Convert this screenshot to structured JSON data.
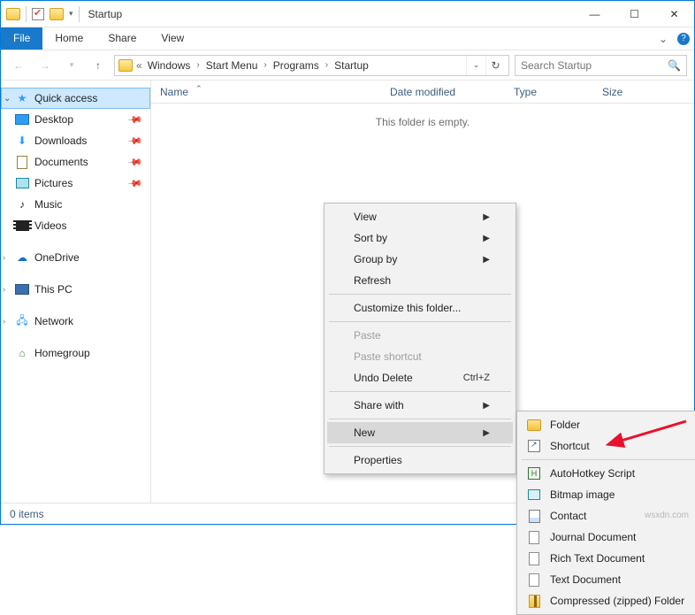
{
  "window": {
    "title": "Startup"
  },
  "ribbon": {
    "file": "File",
    "tabs": [
      "Home",
      "Share",
      "View"
    ]
  },
  "address": {
    "crumbs": [
      "Windows",
      "Start Menu",
      "Programs",
      "Startup"
    ]
  },
  "search": {
    "placeholder": "Search Startup"
  },
  "nav": {
    "quick_access": "Quick access",
    "pinned": [
      {
        "label": "Desktop"
      },
      {
        "label": "Downloads"
      },
      {
        "label": "Documents"
      },
      {
        "label": "Pictures"
      }
    ],
    "recent": [
      {
        "label": "Music"
      },
      {
        "label": "Videos"
      }
    ],
    "onedrive": "OneDrive",
    "thispc": "This PC",
    "network": "Network",
    "homegroup": "Homegroup"
  },
  "columns": {
    "name": "Name",
    "date": "Date modified",
    "type": "Type",
    "size": "Size"
  },
  "content": {
    "empty": "This folder is empty."
  },
  "context_menu": {
    "view": "View",
    "sort": "Sort by",
    "group": "Group by",
    "refresh": "Refresh",
    "customize": "Customize this folder...",
    "paste": "Paste",
    "paste_shortcut": "Paste shortcut",
    "undo": "Undo Delete",
    "undo_key": "Ctrl+Z",
    "share": "Share with",
    "new": "New",
    "properties": "Properties"
  },
  "new_submenu": {
    "folder": "Folder",
    "shortcut": "Shortcut",
    "ahk": "AutoHotkey Script",
    "bmp": "Bitmap image",
    "contact": "Contact",
    "journal": "Journal Document",
    "rtf": "Rich Text Document",
    "txt": "Text Document",
    "zip": "Compressed (zipped) Folder"
  },
  "status": {
    "count": "0 items"
  },
  "watermark": "wsxdn.com"
}
